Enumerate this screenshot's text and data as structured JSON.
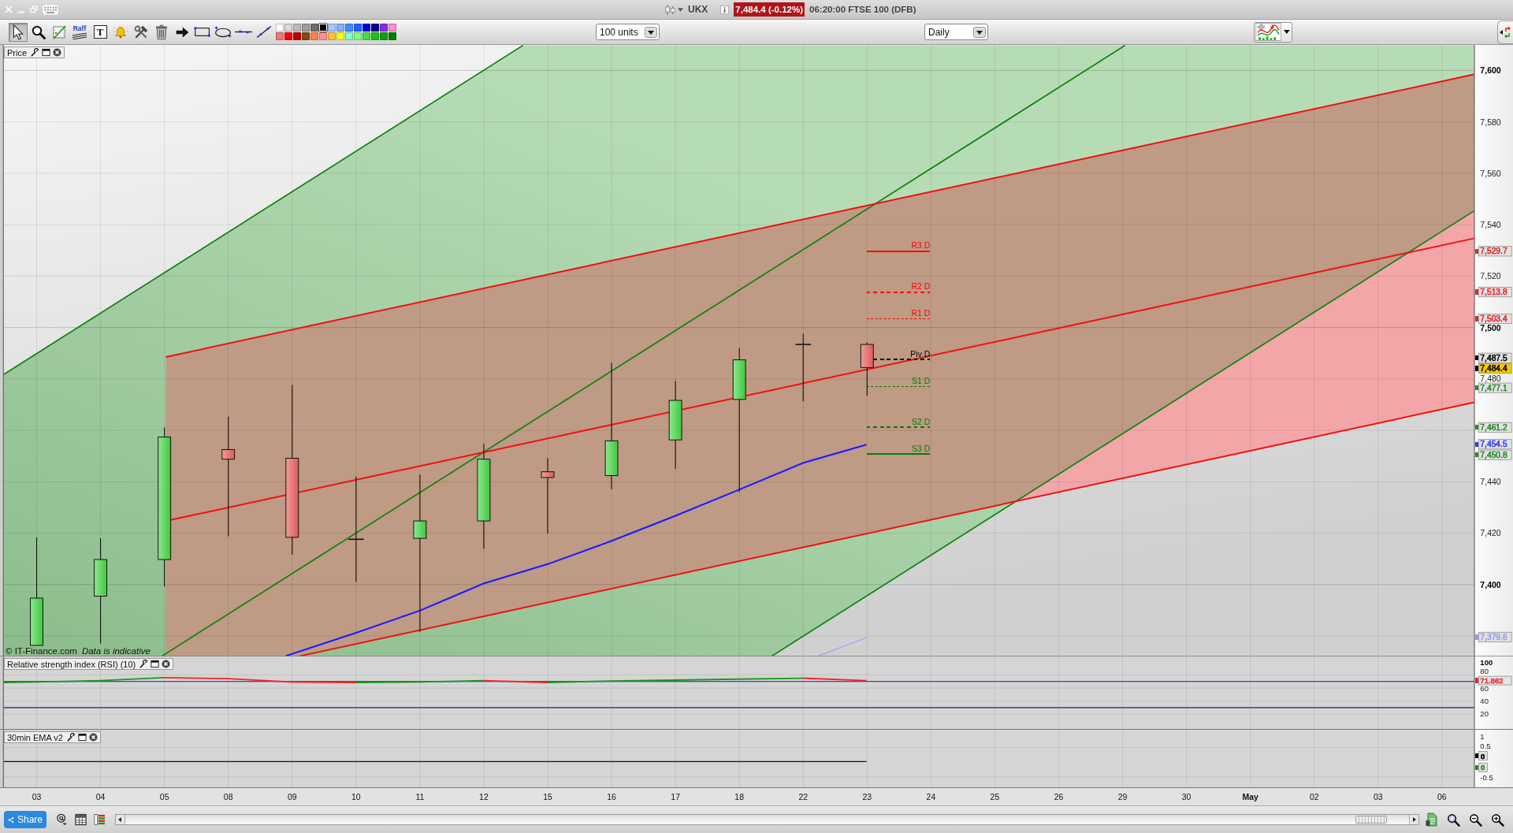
{
  "title_bar": {
    "symbol": "UKX",
    "price_badge": "7,484.4 (-0.12%)",
    "quote": "06:20:00 FTSE 100 (DFB)"
  },
  "toolbar": {
    "tools": [
      {
        "kind": "pointer",
        "selected": true
      },
      {
        "kind": "magnifier",
        "selected": false
      },
      {
        "kind": "line-study",
        "selected": false
      },
      {
        "kind": "raff",
        "label": "Raff",
        "selected": false
      },
      {
        "kind": "text",
        "label": "T",
        "selected": false
      },
      {
        "kind": "alert",
        "selected": false
      },
      {
        "kind": "tools",
        "selected": false
      },
      {
        "kind": "trash",
        "selected": false
      },
      {
        "kind": "arrow",
        "selected": false
      },
      {
        "kind": "rectangle",
        "selected": false
      },
      {
        "kind": "ellipse",
        "selected": false
      },
      {
        "kind": "horizontal-line",
        "selected": false
      },
      {
        "kind": "trend-line",
        "selected": false
      }
    ],
    "palette": [
      {
        "color": "#ffffff",
        "selected": false
      },
      {
        "color": "#d9d9d9",
        "selected": false
      },
      {
        "color": "#bcbcbc",
        "selected": false
      },
      {
        "color": "#9e9e9e",
        "selected": false
      },
      {
        "color": "#6e6e6e",
        "selected": false
      },
      {
        "color": "#000000",
        "selected": true
      },
      {
        "color": "#a9c8ff",
        "selected": false
      },
      {
        "color": "#7fb0ff",
        "selected": false
      },
      {
        "color": "#3f8cff",
        "selected": false
      },
      {
        "color": "#2060ff",
        "selected": false
      },
      {
        "color": "#0000e6",
        "selected": false
      },
      {
        "color": "#00008b",
        "selected": false
      },
      {
        "color": "#8a2be2",
        "selected": false
      },
      {
        "color": "#ff8fc8",
        "selected": false
      },
      {
        "color": "#f07878",
        "selected": false
      },
      {
        "color": "#ff0000",
        "selected": false
      },
      {
        "color": "#c00000",
        "selected": false
      },
      {
        "color": "#8b4513",
        "selected": false
      },
      {
        "color": "#ff8040",
        "selected": false
      },
      {
        "color": "#ff9090",
        "selected": false
      },
      {
        "color": "#ffc040",
        "selected": false
      },
      {
        "color": "#ffff00",
        "selected": false
      },
      {
        "color": "#80ffd0",
        "selected": false
      },
      {
        "color": "#80ff80",
        "selected": false
      },
      {
        "color": "#40e040",
        "selected": false
      },
      {
        "color": "#20c020",
        "selected": false
      },
      {
        "color": "#10a010",
        "selected": false
      },
      {
        "color": "#008000",
        "selected": false
      }
    ],
    "units_select": "100 units",
    "interval_select": "Daily"
  },
  "price_panel": {
    "title": "Price",
    "copyright": "© IT-Finance.com",
    "disclaimer": "Data is indicative",
    "pivots": [
      {
        "label": "R3 D",
        "color": "#ff0000",
        "kind": "solid"
      },
      {
        "label": "R2 D",
        "color": "#ff0000",
        "kind": "dashed"
      },
      {
        "label": "R1 D",
        "color": "#ff0000",
        "kind": "dotted"
      },
      {
        "label": "Piv D",
        "color": "#000000",
        "kind": "dashed"
      },
      {
        "label": "S1 D",
        "color": "#008000",
        "kind": "dotted"
      },
      {
        "label": "S2 D",
        "color": "#008000",
        "kind": "dashed"
      },
      {
        "label": "S3 D",
        "color": "#008000",
        "kind": "solid"
      }
    ],
    "axis_ticks": [
      {
        "label": "7,600",
        "major": true
      },
      {
        "label": "7,580",
        "major": false
      },
      {
        "label": "7,560",
        "major": false
      },
      {
        "label": "7,540",
        "major": false
      },
      {
        "label": "7,520",
        "major": false
      },
      {
        "label": "7,500",
        "major": true
      },
      {
        "label": "7,480",
        "major": false
      },
      {
        "label": "7,440",
        "major": false
      },
      {
        "label": "7,420",
        "major": false
      },
      {
        "label": "7,400",
        "major": true
      }
    ],
    "price_tags": [
      {
        "label": "7,529.7",
        "color": "#e8262d",
        "highlighted": false
      },
      {
        "label": "7,513.8",
        "color": "#e8262d",
        "highlighted": false
      },
      {
        "label": "7,503.4",
        "color": "#e8262d",
        "highlighted": false
      },
      {
        "label": "7,487.5",
        "color": "#000000",
        "highlighted": false
      },
      {
        "label": "7,484.4",
        "color": "#000000",
        "highlighted": true
      },
      {
        "label": "7,477.1",
        "color": "#2a8a2a",
        "highlighted": false
      },
      {
        "label": "7,461.2",
        "color": "#2a8a2a",
        "highlighted": false
      },
      {
        "label": "7,454.5",
        "color": "#2b3bff",
        "highlighted": false
      },
      {
        "label": "7,450.8",
        "color": "#2a8a2a",
        "highlighted": false
      },
      {
        "label": "7,379.6",
        "color": "#9a9ae6",
        "highlighted": false
      }
    ]
  },
  "rsi_panel": {
    "title": "Relative strength index (RSI) (10)",
    "axis_ticks": [
      {
        "label": "100",
        "major": true
      },
      {
        "label": "80",
        "major": false
      },
      {
        "label": "60",
        "major": false
      },
      {
        "label": "40",
        "major": false
      },
      {
        "label": "20",
        "major": false
      }
    ],
    "value_tag": "71.862"
  },
  "ema_panel": {
    "title": "30min EMA v2",
    "axis_ticks": [
      {
        "label": "1",
        "major": false
      },
      {
        "label": "0.5",
        "major": false
      },
      {
        "label": "-0.5",
        "major": false
      }
    ],
    "value_tags": [
      {
        "label": "0",
        "color": "#000000"
      },
      {
        "label": "0",
        "color": "#2a8a2a"
      }
    ]
  },
  "date_axis": [
    {
      "label": "03",
      "major": false
    },
    {
      "label": "04",
      "major": false
    },
    {
      "label": "05",
      "major": false
    },
    {
      "label": "08",
      "major": false
    },
    {
      "label": "09",
      "major": false
    },
    {
      "label": "10",
      "major": false
    },
    {
      "label": "11",
      "major": false
    },
    {
      "label": "12",
      "major": false
    },
    {
      "label": "15",
      "major": false
    },
    {
      "label": "16",
      "major": false
    },
    {
      "label": "17",
      "major": false
    },
    {
      "label": "18",
      "major": false
    },
    {
      "label": "22",
      "major": false
    },
    {
      "label": "23",
      "major": false
    },
    {
      "label": "24",
      "major": false
    },
    {
      "label": "25",
      "major": false
    },
    {
      "label": "26",
      "major": false
    },
    {
      "label": "29",
      "major": false
    },
    {
      "label": "30",
      "major": false
    },
    {
      "label": "May",
      "major": true
    },
    {
      "label": "02",
      "major": false
    },
    {
      "label": "03",
      "major": false
    },
    {
      "label": "06",
      "major": false
    }
  ],
  "bottom_bar": {
    "share_button": "Share"
  }
}
